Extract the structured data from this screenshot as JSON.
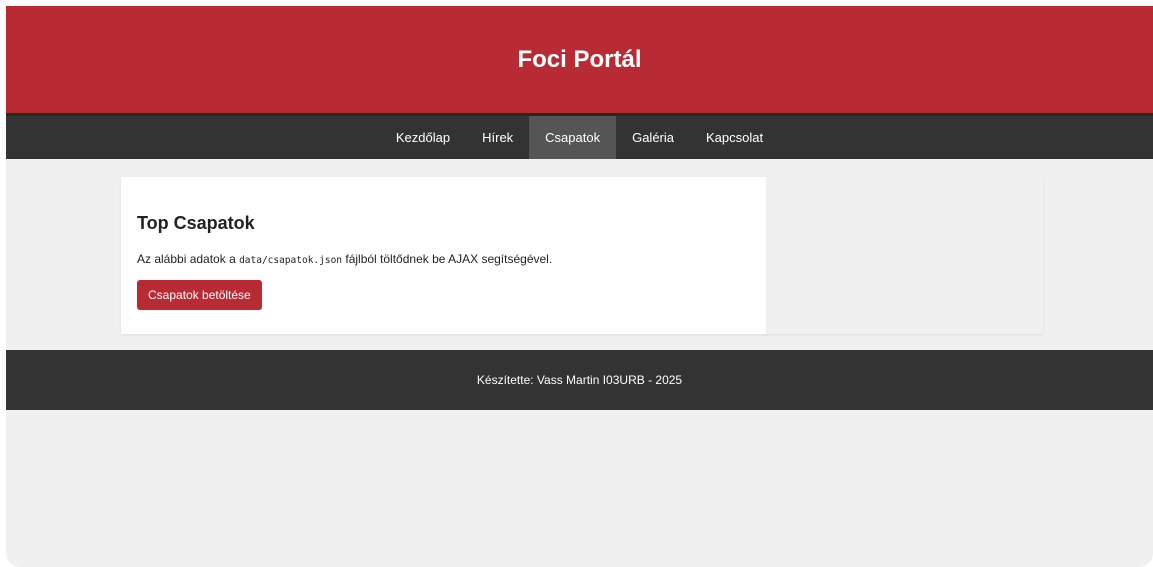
{
  "header": {
    "title": "Foci Portál"
  },
  "nav": {
    "items": [
      {
        "label": "Kezdőlap"
      },
      {
        "label": "Hírek"
      },
      {
        "label": "Csapatok"
      },
      {
        "label": "Galéria"
      },
      {
        "label": "Kapcsolat"
      }
    ],
    "active": "Csapatok"
  },
  "main": {
    "heading": "Top Csapatok",
    "description_prefix": "Az alábbi adatok a ",
    "description_code": "data/csapatok.json",
    "description_suffix": " fájlból töltődnek be AJAX segítségével.",
    "load_button_label": "Csapatok betöltése"
  },
  "footer": {
    "text": "Készítette: Vass Martin I03URB - 2025"
  },
  "colors": {
    "brand": "#b82b35",
    "nav_bg": "#333333",
    "nav_active": "#555555",
    "page_bg": "#f0f0f0"
  }
}
